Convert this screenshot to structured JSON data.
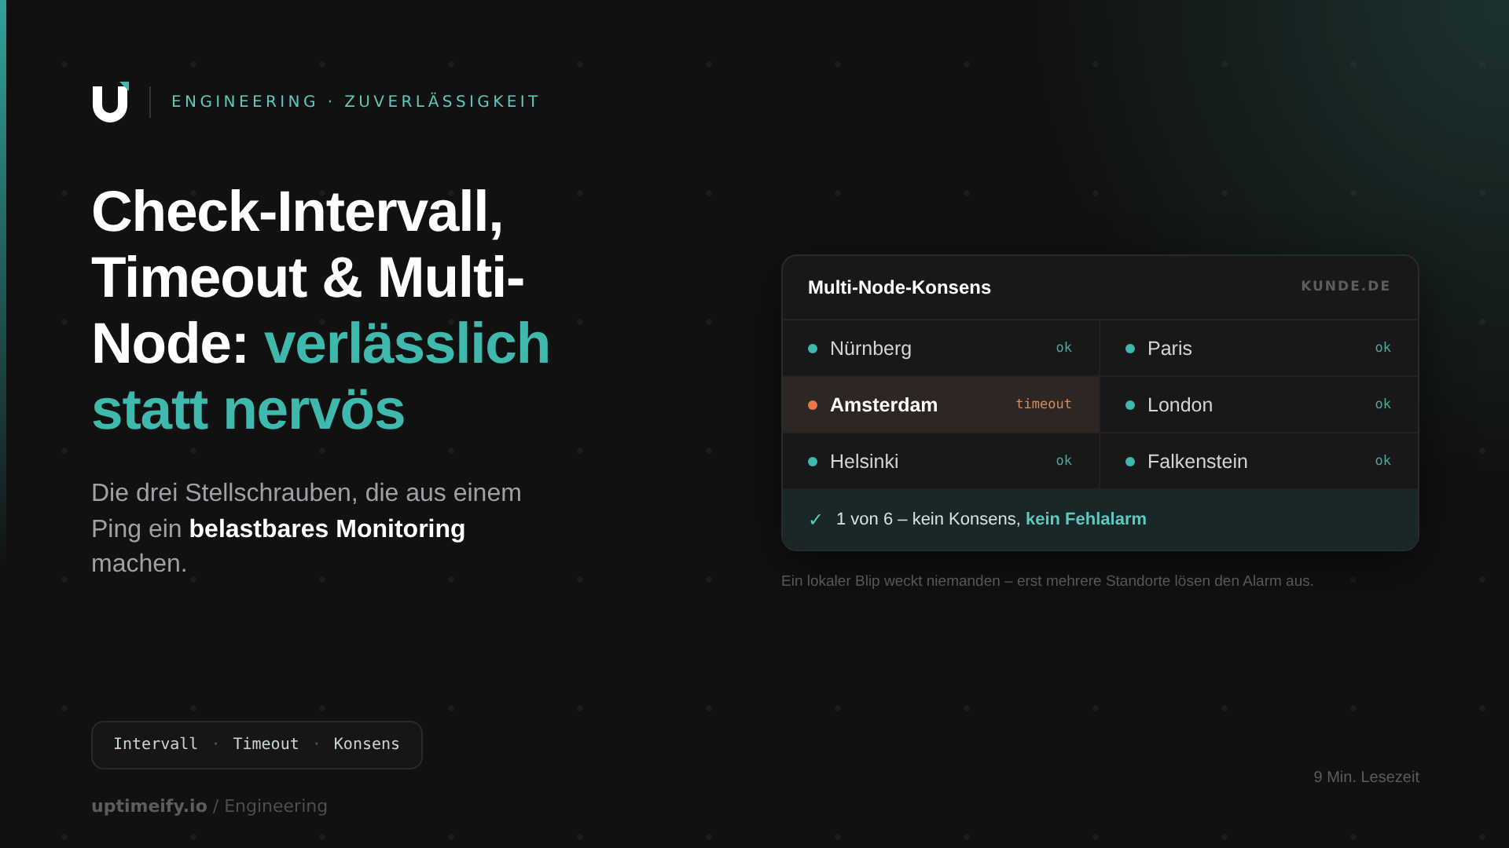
{
  "brand": {
    "kicker": "ENGINEERING · ZUVERLÄSSIGKEIT"
  },
  "headline": {
    "text": "Check-Intervall, Timeout & Multi-Node:",
    "highlight": "verlässlich statt nervös"
  },
  "subtitle": "Die drei Stellschrauben, die aus einem Ping ein **belastbares Monitoring** machen.",
  "tags": {
    "items": [
      "Intervall",
      "Timeout",
      "Konsens"
    ],
    "separator": "·"
  },
  "footer": {
    "source": "**uptimeify.io** / Engineering",
    "reading_time": "9 Min. Lesezeit"
  },
  "card": {
    "title": "Multi-Node-Konsens",
    "domain": "KUNDE.DE",
    "nodes": [
      {
        "name": "Nürnberg",
        "status": "ok",
        "color": "#3fb8ae",
        "failed": false
      },
      {
        "name": "Paris",
        "status": "ok",
        "color": "#3fb8ae",
        "failed": false
      },
      {
        "name": "Amsterdam",
        "status": "timeout",
        "color": "#e8764a",
        "failed": true
      },
      {
        "name": "London",
        "status": "ok",
        "color": "#3fb8ae",
        "failed": false
      },
      {
        "name": "Helsinki",
        "status": "ok",
        "color": "#3fb8ae",
        "failed": false
      },
      {
        "name": "Falkenstein",
        "status": "ok",
        "color": "#3fb8ae",
        "failed": false
      }
    ],
    "result": {
      "icon": "✓",
      "text": "1 von 6 – kein Konsens,",
      "highlight": "kein Fehlalarm"
    },
    "caption": "Ein lokaler Blip weckt niemanden – erst mehrere Standorte lösen den Alarm aus."
  }
}
